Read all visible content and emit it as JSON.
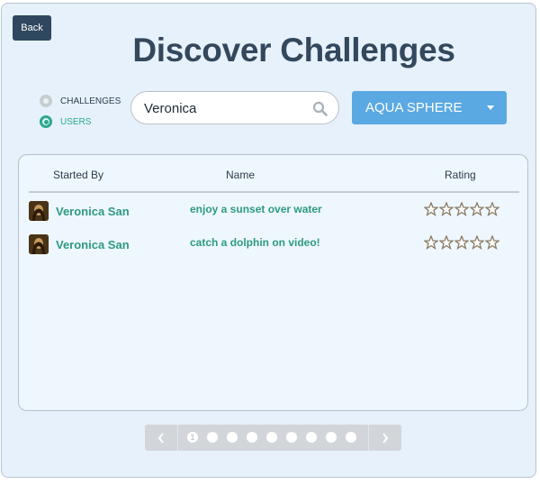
{
  "back_label": "Back",
  "title": "Discover Challenges",
  "filter": {
    "options": [
      {
        "label": "CHALLENGES",
        "selected": false
      },
      {
        "label": "USERS",
        "selected": true
      }
    ]
  },
  "search": {
    "value": "Veronica",
    "placeholder": ""
  },
  "category": {
    "selected": "AQUA SPHERE"
  },
  "table": {
    "columns": [
      "Started By",
      "Name",
      "Rating"
    ],
    "rows": [
      {
        "user": "Veronica San",
        "challenge": "enjoy a sunset over water",
        "rating": 0
      },
      {
        "user": "Veronica San",
        "challenge": "catch a dolphin on video!",
        "rating": 0
      }
    ]
  },
  "pagination": {
    "current_page": "1",
    "total_pages": 9,
    "prev_icon": "chevron-left-icon",
    "next_icon": "chevron-right-icon"
  },
  "colors": {
    "accent_teal": "#2aaa8a",
    "dropdown_blue": "#5aa9e2",
    "title_dark": "#34485d",
    "back_button": "#2f475f"
  }
}
